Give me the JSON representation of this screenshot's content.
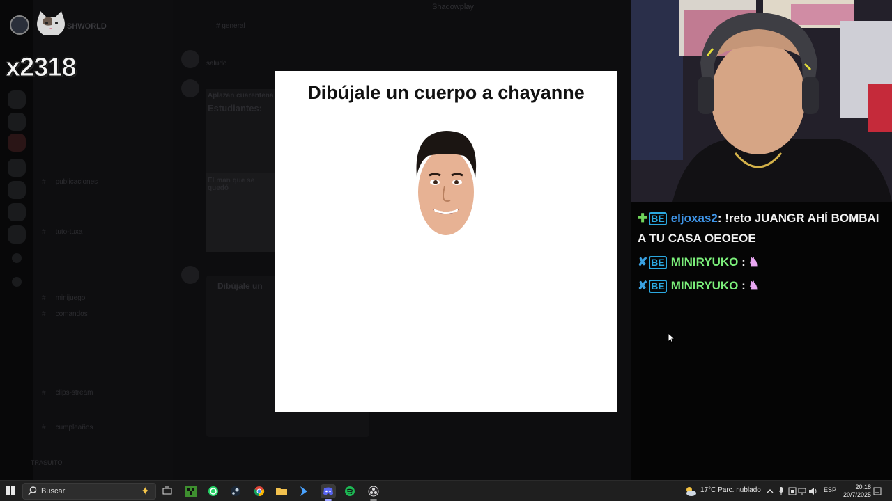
{
  "background": {
    "server_name": "SHWORLD",
    "top_title": "Shadowplay",
    "chat_header": "# general",
    "channels": [
      "",
      "",
      "",
      "publicaciones",
      "",
      "tuto-tuxa",
      "",
      "",
      "minijuego",
      "comandos",
      "",
      "",
      "",
      "clips-stream",
      "",
      "cumpleaños",
      ""
    ],
    "user_name": "TRASUITO",
    "message_text": "saludo",
    "card1_heading": "Aplazan cuarentena",
    "card1_sub": "Estudiantes:",
    "card1_caption": "El man que se quedó",
    "card2_title": "Dibújale un"
  },
  "overlay": {
    "counter": "x2318"
  },
  "modal": {
    "title": "Dibújale un cuerpo a chayanne"
  },
  "chat": {
    "messages": [
      {
        "user": "eljoxas2",
        "text": ": !reto JUANGR AHÍ BOMBAI",
        "text2": "A TU CASA OEOEOE",
        "user_color": "#3f95e8",
        "badge": "✚"
      },
      {
        "user": "MINIRYUKO",
        "text": " :",
        "user_color": "#7cf07b",
        "badge": "✘"
      },
      {
        "user": "MINIRYUKO",
        "text": " :",
        "user_color": "#7cf07b",
        "badge": "✘"
      }
    ]
  },
  "taskbar": {
    "search_placeholder": "Buscar",
    "weather": "17°C  Parc. nublado",
    "language": "ESP",
    "time": "20:18",
    "date": "20/7/2025"
  }
}
